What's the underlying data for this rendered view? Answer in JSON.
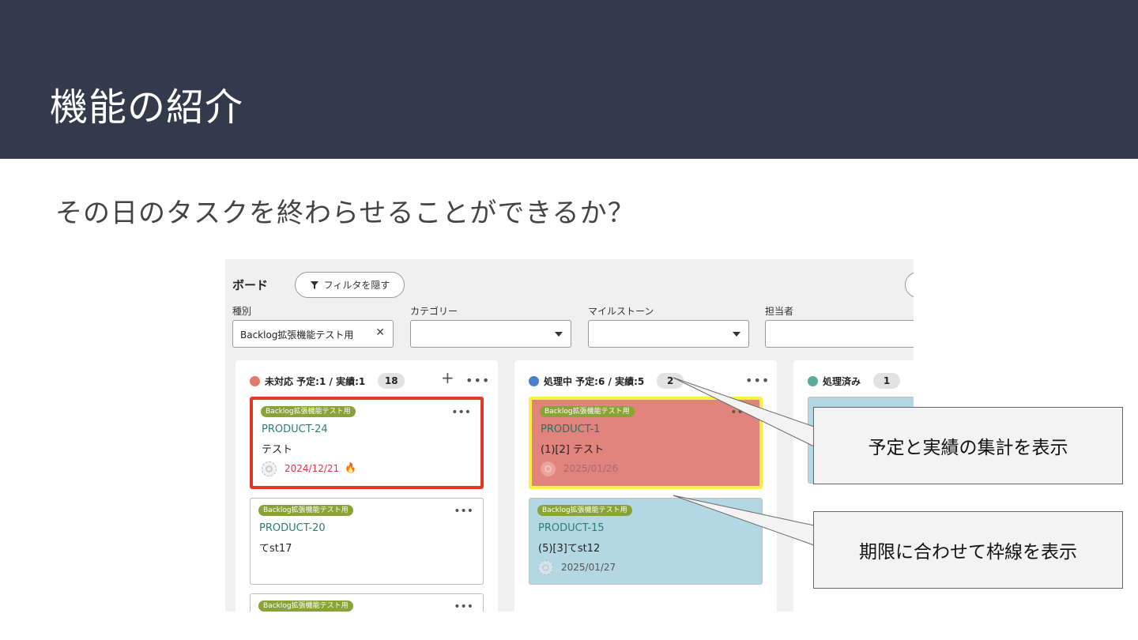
{
  "header": {
    "title": "機能の紹介"
  },
  "subtitle": "その日のタスクを終わらせることができるか？",
  "board": {
    "title": "ボード",
    "filter_button": "フィルタを隠す",
    "filters": [
      {
        "label": "種別",
        "value": "Backlog拡張機能テスト用",
        "clear": "✕"
      },
      {
        "label": "カテゴリー",
        "value": ""
      },
      {
        "label": "マイルストーン",
        "value": ""
      },
      {
        "label": "担当者",
        "value": ""
      }
    ],
    "columns": [
      {
        "name": "未対応 予定:1 / 実績:1",
        "count": "18",
        "color": "#e07a6a",
        "cards": [
          {
            "tag": "Backlog拡張機能テスト用",
            "key": "PRODUCT-24",
            "summary": "テスト",
            "due": "2024/12/21",
            "flag": "🔥"
          },
          {
            "tag": "Backlog拡張機能テスト用",
            "key": "PRODUCT-20",
            "summary": "てst17"
          },
          {
            "tag": "Backlog拡張機能テスト用"
          }
        ]
      },
      {
        "name": "処理中 予定:6 / 実績:5",
        "count": "2",
        "color": "#4a7fcf",
        "cards": [
          {
            "tag": "Backlog拡張機能テスト用",
            "key": "PRODUCT-1",
            "summary": "(1)[2] テスト",
            "due": "2025/01/26"
          },
          {
            "tag": "Backlog拡張機能テスト用",
            "key": "PRODUCT-15",
            "summary": "(5)[3]てst12",
            "due": "2025/01/27"
          }
        ]
      },
      {
        "name": "処理済み",
        "count": "1",
        "color": "#5aab9a"
      }
    ]
  },
  "callouts": {
    "summary": "予定と実績の集計を表示",
    "border": "期限に合わせて枠線を表示"
  },
  "colors": {
    "header_bg": "#323a4b",
    "overdue_border": "#e23a2a",
    "warning_border": "#f7f14a",
    "warning_fill": "#e2847e",
    "card_blue": "#b3d8e4",
    "tag_green": "#8aa336"
  },
  "icons": {
    "more": "•••",
    "add": "+"
  }
}
